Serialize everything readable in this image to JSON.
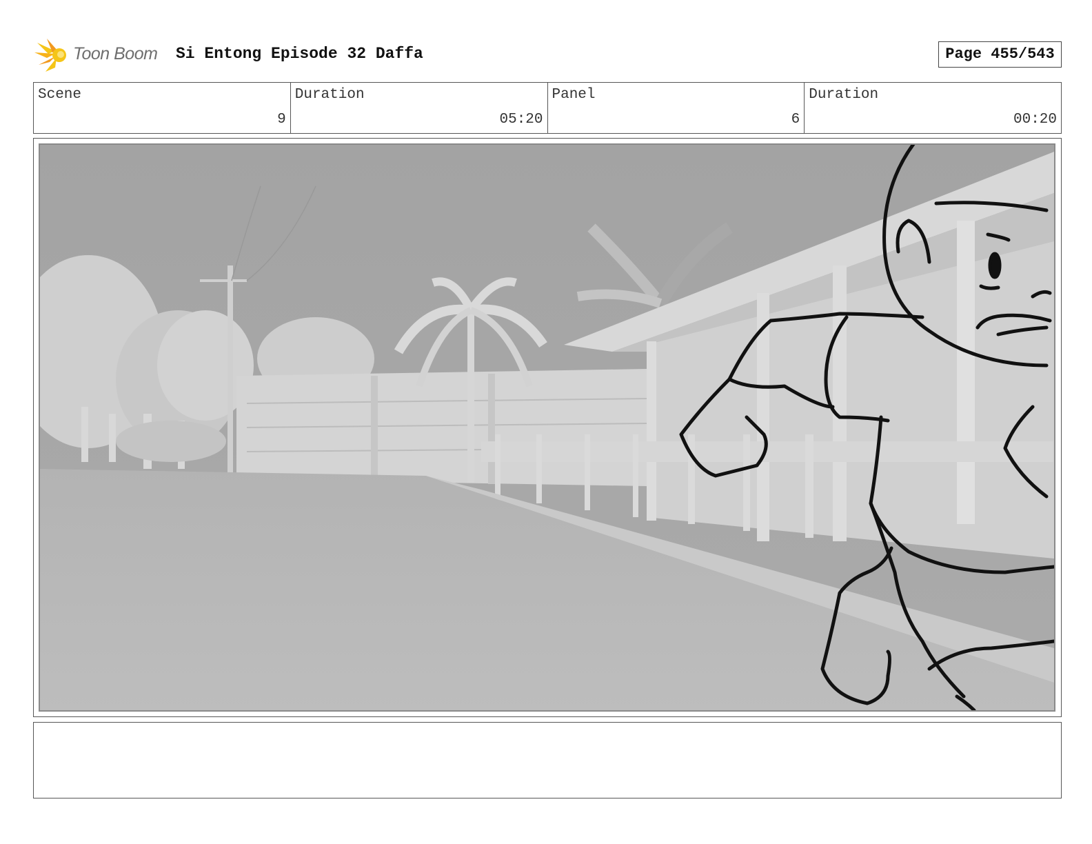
{
  "header": {
    "logo_text": "Toon Boom",
    "project_title": "Si Entong Episode 32 Daffa",
    "page_label": "Page 455/543"
  },
  "info": {
    "scene_label": "Scene",
    "scene_value": "9",
    "scene_duration_label": "Duration",
    "scene_duration_value": "05:20",
    "panel_label": "Panel",
    "panel_value": "6",
    "panel_duration_label": "Duration",
    "panel_duration_value": "00:20"
  },
  "notes": {
    "text": ""
  },
  "colors": {
    "logo_yellow": "#f5c518",
    "logo_orange": "#f29a1f",
    "sky": "#a6a6a6",
    "road": "#b6b6b6",
    "sketch_line": "#111111"
  }
}
